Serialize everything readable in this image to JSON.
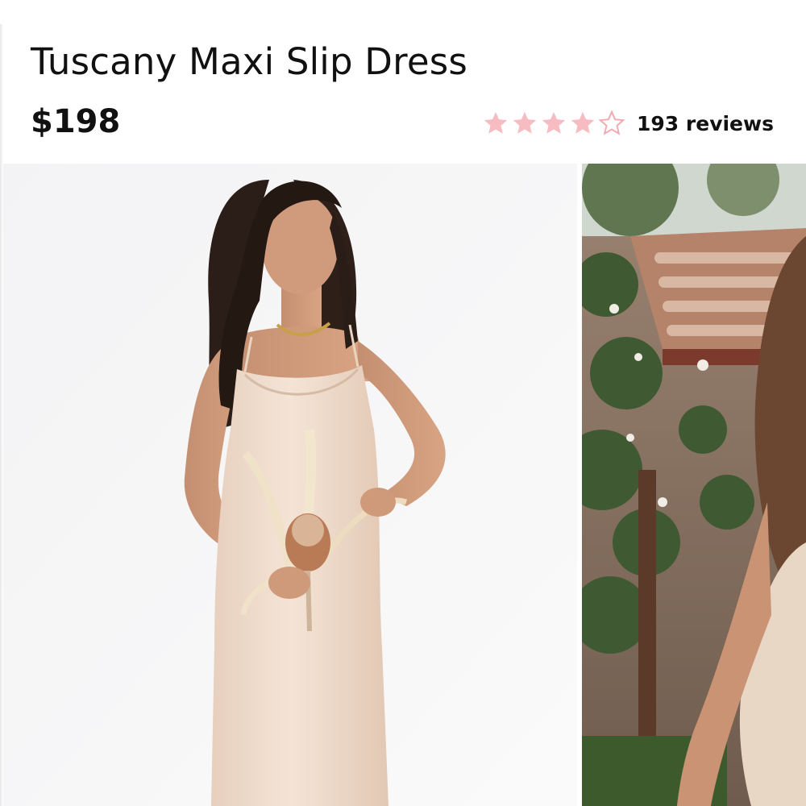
{
  "product": {
    "title": "Tuscany Maxi Slip Dress",
    "price": "$198",
    "rating": {
      "value": 4,
      "max": 5,
      "reviews_label": "193 reviews"
    }
  },
  "colors": {
    "star_filled": "#f7bcc2",
    "star_empty_outline": "#f2aab3",
    "text": "#111111",
    "dress": "#efdccb",
    "background_photo": "#f6f6f7"
  },
  "icons": {
    "star": "star-icon",
    "star_empty": "star-outline-icon"
  }
}
